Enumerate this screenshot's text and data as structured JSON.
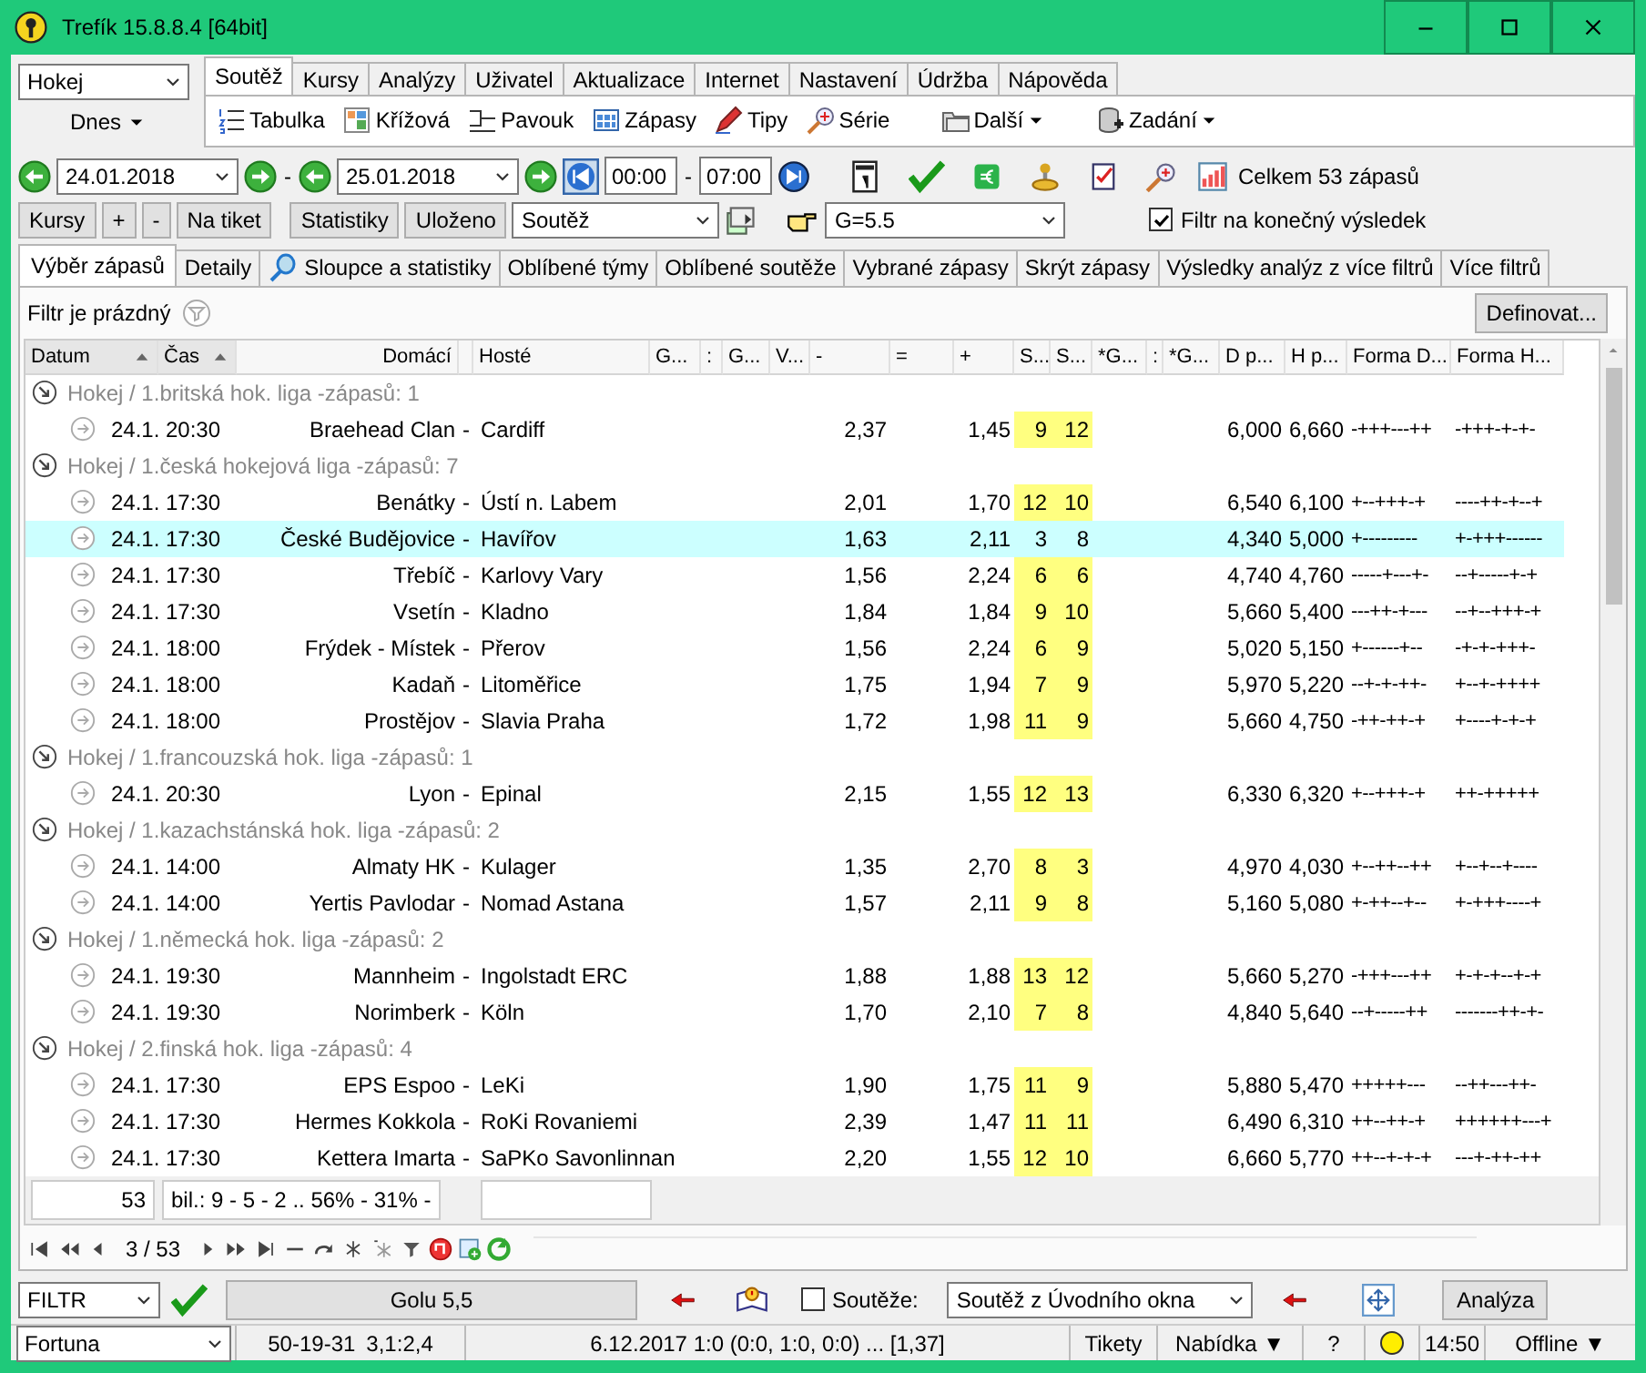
{
  "window": {
    "title": "Trefík 15.8.8.4 [64bit]"
  },
  "sport_select": {
    "value": "Hokej"
  },
  "day_button": {
    "label": "Dnes"
  },
  "menu_tabs": [
    {
      "label": "Soutěž",
      "selected": true
    },
    {
      "label": "Kursy",
      "selected": false
    },
    {
      "label": "Analýzy",
      "selected": false
    },
    {
      "label": "Uživatel",
      "selected": false
    },
    {
      "label": "Aktualizace",
      "selected": false
    },
    {
      "label": "Internet",
      "selected": false
    },
    {
      "label": "Nastavení",
      "selected": false
    },
    {
      "label": "Údržba",
      "selected": false
    },
    {
      "label": "Nápověda",
      "selected": false
    }
  ],
  "toolbar": [
    {
      "label": "Tabulka",
      "dropdown": false
    },
    {
      "label": "Křížová",
      "dropdown": false
    },
    {
      "label": "Pavouk",
      "dropdown": false
    },
    {
      "label": "Zápasy",
      "dropdown": false
    },
    {
      "label": "Tipy",
      "dropdown": false
    },
    {
      "label": "Série",
      "dropdown": false
    },
    {
      "label": "Další",
      "dropdown": true
    },
    {
      "label": "Zadání",
      "dropdown": true
    }
  ],
  "date_filter": {
    "from": "24.01.2018",
    "date_separator": "-",
    "to": "25.01.2018",
    "time_from": "00:00",
    "time_separator": "-",
    "time_to": "07:00",
    "total": "Celkem 53 zápasů"
  },
  "actions": {
    "buttons": [
      "Kursy",
      "+",
      "-",
      "Na tiket"
    ],
    "buttons_2": [
      "Statistiky",
      "Uloženo"
    ],
    "competition_select": "Soutěž",
    "goal_select": "G=5.5",
    "final_result_filter": {
      "label": "Filtr na konečný výsledek",
      "checked": true
    }
  },
  "view_tabs": [
    {
      "label": "Výběr zápasů",
      "selected": true
    },
    {
      "label": "Detaily",
      "selected": false
    },
    {
      "label": "Sloupce a statistiky",
      "selected": false
    },
    {
      "label": "Oblíbené týmy",
      "selected": false
    },
    {
      "label": "Oblíbené soutěže",
      "selected": false
    },
    {
      "label": "Vybrané zápasy",
      "selected": false
    },
    {
      "label": "Skrýt zápasy",
      "selected": false
    },
    {
      "label": "Výsledky analýz z více filtrů",
      "selected": false
    },
    {
      "label": "Více filtrů",
      "selected": false
    }
  ],
  "filter": {
    "status": "Filtr je prázdný",
    "define_button": "Definovat..."
  },
  "table": {
    "columns": [
      {
        "label": "Datum",
        "sorted": true
      },
      {
        "label": "Čas",
        "sorted": true
      },
      {
        "label": "Domácí",
        "sorted": false
      },
      {
        "label": "Hosté",
        "sorted": false
      },
      {
        "label": "G...",
        "sorted": false
      },
      {
        "label": ":",
        "sorted": false
      },
      {
        "label": "G...",
        "sorted": false
      },
      {
        "label": "V...",
        "sorted": false
      },
      {
        "label": "-",
        "sorted": false
      },
      {
        "label": "=",
        "sorted": false
      },
      {
        "label": "+",
        "sorted": false
      },
      {
        "label": "S...",
        "sorted": false
      },
      {
        "label": "S...",
        "sorted": false
      },
      {
        "label": "*G...",
        "sorted": false
      },
      {
        "label": ":",
        "sorted": false
      },
      {
        "label": "*G...",
        "sorted": false
      },
      {
        "label": "D p...",
        "sorted": false
      },
      {
        "label": "H p...",
        "sorted": false
      },
      {
        "label": "Forma D...",
        "sorted": false
      },
      {
        "label": "Forma H...",
        "sorted": false
      }
    ],
    "groups": [
      {
        "title": "Hokej / 1.britská hok. liga -zápasů: 1",
        "expanded": true,
        "matches": [
          {
            "date": "24.1.",
            "time": "20:30",
            "home": "Braehead Clan",
            "sep": "-",
            "away": "Cardiff",
            "minus": "2,37",
            "plus": "1,45",
            "s1": "9",
            "s2": "12",
            "d_p": "6,000",
            "h_p": "6,660",
            "form_d": "-+++---++",
            "form_h": "-+++-+-+-",
            "selected": false
          }
        ]
      },
      {
        "title": "Hokej / 1.česká hokejová liga -zápasů: 7",
        "expanded": true,
        "matches": [
          {
            "date": "24.1.",
            "time": "17:30",
            "home": "Benátky",
            "sep": "-",
            "away": "Ústí n. Labem",
            "minus": "2,01",
            "plus": "1,70",
            "s1": "12",
            "s2": "10",
            "d_p": "6,540",
            "h_p": "6,100",
            "form_d": "+--+++-+",
            "form_h": "----++-+--+",
            "selected": false
          },
          {
            "date": "24.1.",
            "time": "17:30",
            "home": "České Budějovice",
            "sep": "-",
            "away": "Havířov",
            "minus": "1,63",
            "plus": "2,11",
            "s1": "3",
            "s2": "8",
            "d_p": "4,340",
            "h_p": "5,000",
            "form_d": "+---------",
            "form_h": "+-+++------",
            "selected": true
          },
          {
            "date": "24.1.",
            "time": "17:30",
            "home": "Třebíč",
            "sep": "-",
            "away": "Karlovy Vary",
            "minus": "1,56",
            "plus": "2,24",
            "s1": "6",
            "s2": "6",
            "d_p": "4,740",
            "h_p": "4,760",
            "form_d": "-----+---+-",
            "form_h": "--+-----+-+",
            "selected": false
          },
          {
            "date": "24.1.",
            "time": "17:30",
            "home": "Vsetín",
            "sep": "-",
            "away": "Kladno",
            "minus": "1,84",
            "plus": "1,84",
            "s1": "9",
            "s2": "10",
            "d_p": "5,660",
            "h_p": "5,400",
            "form_d": "---++-+---",
            "form_h": "--+--+++-+",
            "selected": false
          },
          {
            "date": "24.1.",
            "time": "18:00",
            "home": "Frýdek - Místek",
            "sep": "-",
            "away": "Přerov",
            "minus": "1,56",
            "plus": "2,24",
            "s1": "6",
            "s2": "9",
            "d_p": "5,020",
            "h_p": "5,150",
            "form_d": "+------+--",
            "form_h": "-+-+-+++-",
            "selected": false
          },
          {
            "date": "24.1.",
            "time": "18:00",
            "home": "Kadaň",
            "sep": "-",
            "away": "Litoměřice",
            "minus": "1,75",
            "plus": "1,94",
            "s1": "7",
            "s2": "9",
            "d_p": "5,970",
            "h_p": "5,220",
            "form_d": "--+-+-++-",
            "form_h": "+--+-++++",
            "selected": false
          },
          {
            "date": "24.1.",
            "time": "18:00",
            "home": "Prostějov",
            "sep": "-",
            "away": "Slavia Praha",
            "minus": "1,72",
            "plus": "1,98",
            "s1": "11",
            "s2": "9",
            "d_p": "5,660",
            "h_p": "4,750",
            "form_d": "-++-++-+",
            "form_h": "+----+-+-+",
            "selected": false
          }
        ]
      },
      {
        "title": "Hokej / 1.francouzská hok. liga -zápasů: 1",
        "expanded": true,
        "matches": [
          {
            "date": "24.1.",
            "time": "20:30",
            "home": "Lyon",
            "sep": "-",
            "away": "Epinal",
            "minus": "2,15",
            "plus": "1,55",
            "s1": "12",
            "s2": "13",
            "d_p": "6,330",
            "h_p": "6,320",
            "form_d": "+--+++-+",
            "form_h": "++-+++++",
            "selected": false
          }
        ]
      },
      {
        "title": "Hokej / 1.kazachstánská hok. liga -zápasů: 2",
        "expanded": true,
        "matches": [
          {
            "date": "24.1.",
            "time": "14:00",
            "home": "Almaty HK",
            "sep": "-",
            "away": "Kulager",
            "minus": "1,35",
            "plus": "2,70",
            "s1": "8",
            "s2": "3",
            "d_p": "4,970",
            "h_p": "4,030",
            "form_d": "+--++--++",
            "form_h": "+--+--+----",
            "selected": false
          },
          {
            "date": "24.1.",
            "time": "14:00",
            "home": "Yertis Pavlodar",
            "sep": "-",
            "away": "Nomad Astana",
            "minus": "1,57",
            "plus": "2,11",
            "s1": "9",
            "s2": "8",
            "d_p": "5,160",
            "h_p": "5,080",
            "form_d": "+-++--+--",
            "form_h": "+-+++----+",
            "selected": false
          }
        ]
      },
      {
        "title": "Hokej / 1.německá hok. liga -zápasů: 2",
        "expanded": true,
        "matches": [
          {
            "date": "24.1.",
            "time": "19:30",
            "home": "Mannheim",
            "sep": "-",
            "away": "Ingolstadt ERC",
            "minus": "1,88",
            "plus": "1,88",
            "s1": "13",
            "s2": "12",
            "d_p": "5,660",
            "h_p": "5,270",
            "form_d": "-+++---++",
            "form_h": "+-+-+--+-+",
            "selected": false
          },
          {
            "date": "24.1.",
            "time": "19:30",
            "home": "Norimberk",
            "sep": "-",
            "away": "Köln",
            "minus": "1,70",
            "plus": "2,10",
            "s1": "7",
            "s2": "8",
            "d_p": "4,840",
            "h_p": "5,640",
            "form_d": "--+-----++",
            "form_h": "-------++-+-",
            "selected": false
          }
        ]
      },
      {
        "title": "Hokej / 2.finská hok. liga -zápasů: 4",
        "expanded": true,
        "matches": [
          {
            "date": "24.1.",
            "time": "17:30",
            "home": "EPS Espoo",
            "sep": "-",
            "away": "LeKi",
            "minus": "1,90",
            "plus": "1,75",
            "s1": "11",
            "s2": "9",
            "d_p": "5,880",
            "h_p": "5,470",
            "form_d": "+++++---",
            "form_h": "--++---++-",
            "selected": false
          },
          {
            "date": "24.1.",
            "time": "17:30",
            "home": "Hermes Kokkola",
            "sep": "-",
            "away": "RoKi Rovaniemi",
            "minus": "2,39",
            "plus": "1,47",
            "s1": "11",
            "s2": "11",
            "d_p": "6,490",
            "h_p": "6,310",
            "form_d": "++--++-+",
            "form_h": "++++++---+",
            "selected": false
          },
          {
            "date": "24.1.",
            "time": "17:30",
            "home": "Kettera Imarta",
            "sep": "-",
            "away": "SaPKo Savonlinnan",
            "minus": "2,20",
            "plus": "1,55",
            "s1": "12",
            "s2": "10",
            "d_p": "6,660",
            "h_p": "5,770",
            "form_d": "++--+-+-+",
            "form_h": "---+-++-++",
            "selected": false
          }
        ]
      }
    ]
  },
  "table_footer": {
    "count": "53",
    "balance": "bil.: 9 - 5 - 2 .. 56% - 31% -"
  },
  "navigator": {
    "position": "3 / 53"
  },
  "bottom_bar": {
    "filter_select": "FILTR",
    "filter_button": "Golu 5,5",
    "competitions": {
      "label": "Soutěže:",
      "checked": false
    },
    "source_select": "Soutěž z Úvodního okna",
    "analyze_button": "Analýza"
  },
  "status_bar": {
    "bookmaker": "Fortuna",
    "record": "50-19-31",
    "ratio": "3,1:2,4",
    "last_result": "6.12.2017 1:0 (0:0, 1:0, 0:0) ... [1,37]",
    "tickets": "Tikety",
    "offer": "Nabídka ▼",
    "help": "?",
    "clock": "14:50",
    "connection": "Offline ▼"
  }
}
